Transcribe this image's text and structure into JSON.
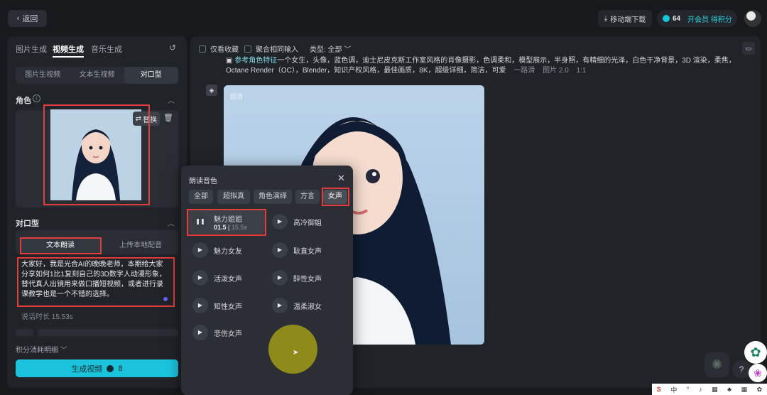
{
  "topbar": {
    "back_label": "返回",
    "mobile_download": "移动端下载",
    "points": "64",
    "vip_label": "开会员 得积分"
  },
  "left": {
    "tabs": [
      "图片生成",
      "视频生成",
      "音乐生成"
    ],
    "subtabs": [
      "图片生视频",
      "文本生视频",
      "对口型"
    ],
    "role_title": "角色",
    "replace_label": "替换",
    "lip_title": "对口型",
    "mode_text": "文本朗读",
    "mode_upload": "上传本地配音",
    "script": "大家好，我是光合AI的晚晚老师，本期给大家分享如何1比1复刻自己的3D数字人动漫形象，替代真人出镜用来做口播短视频，或者进行录课教学也是一个不错的选择。",
    "duration": "说话时长 15.53s",
    "credit_detail": "积分消耗明细",
    "generate_label": "生成视频",
    "generate_cost": "8"
  },
  "main": {
    "check_fav": "仅看收藏",
    "check_agg": "聚合相同输入",
    "type_select": "类型: 全部",
    "prompt_ref": "参考角色特征",
    "prompt": "一个女生，头像，蓝色调，迪士尼皮克斯工作室风格的肖像摄影，色调柔和，模型展示，半身照，有精细的光泽，白色干净背景，3D 渲染，柔焦，Octane Render（OC），Blender，知识产权风格，最佳画质，8K，超级详细，简洁，可爱",
    "prompt_more": "一路滑",
    "meta_model": "图片 2.0",
    "meta_ratio": "1:1",
    "tag_hd": "超清"
  },
  "voice": {
    "title": "朗读音色",
    "filters": [
      "全部",
      "超拟真",
      "角色演绎",
      "方言",
      "女声"
    ],
    "selected": {
      "name": "魅力姐姐",
      "current": "01.5",
      "total": "15.5s"
    },
    "items": [
      "高冷御姐",
      "魅力女友",
      "耿直女声",
      "活泼女声",
      "醉性女声",
      "知性女声",
      "温柔淑女",
      "悲伤女声"
    ]
  },
  "taskbar": [
    "中",
    "°",
    "♪",
    "▦",
    "♣",
    "▦",
    "✿"
  ]
}
